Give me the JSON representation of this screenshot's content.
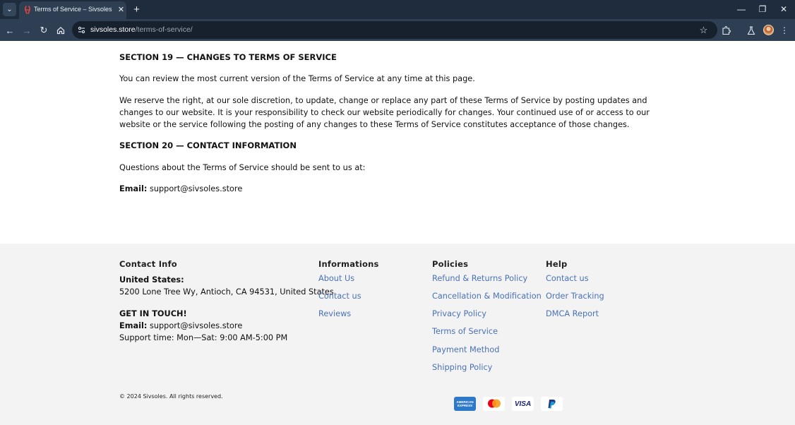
{
  "browser": {
    "tab_title": "Terms of Service – Sivsoles",
    "url_host": "sivsoles.store",
    "url_path": "/terms-of-service/"
  },
  "content": {
    "section19_heading": "SECTION 19 — CHANGES TO TERMS OF SERVICE",
    "section19_p1": "You can review the most current version of the Terms of Service at any time at this page.",
    "section19_p2": "We reserve the right, at our sole discretion, to update, change or replace any part of these Terms of Service by posting updates and changes to our website. It is your responsibility to check our website periodically for changes. Your continued use of or access to our website or the service following the posting of any changes to these Terms of Service constitutes acceptance of those changes.",
    "section20_heading": "SECTION 20 — CONTACT INFORMATION",
    "section20_p1": "Questions about the Terms of Service should be sent to us at:",
    "email_label": "Email:",
    "email_value": "support@sivsoles.store"
  },
  "footer": {
    "contact": {
      "title": "Contact Info",
      "country_label": "United States:",
      "address": "5200 Lone Tree Wy, Antioch, CA 94531, United States",
      "touch_label": "GET IN TOUCH!",
      "email_label": "Email:",
      "email_value": "support@sivsoles.store",
      "support_time": "Support time: Mon—Sat: 9:00 AM-5:00 PM"
    },
    "informations": {
      "title": "Informations",
      "links": [
        "About Us",
        "Contact us",
        "Reviews"
      ]
    },
    "policies": {
      "title": "Policies",
      "links": [
        "Refund & Returns Policy",
        "Cancellation & Modification",
        "Privacy Policy",
        "Terms of Service",
        "Payment Method",
        "Shipping Policy"
      ]
    },
    "help": {
      "title": "Help",
      "links": [
        "Contact us",
        "Order Tracking",
        "DMCA Report"
      ]
    },
    "copyright": "© 2024 Sivsoles. All rights reserved.",
    "payment_icons": [
      "american-express-icon",
      "mastercard-icon",
      "visa-icon",
      "paypal-icon"
    ],
    "payment_text": {
      "amex": "AMERICAN EXPRESS",
      "visa": "VISA"
    }
  },
  "colors": {
    "tabbar": "#1f2c3e",
    "toolbar": "#2f3f53",
    "footer_bg": "#f3f3f3",
    "link": "#4a72b8"
  }
}
